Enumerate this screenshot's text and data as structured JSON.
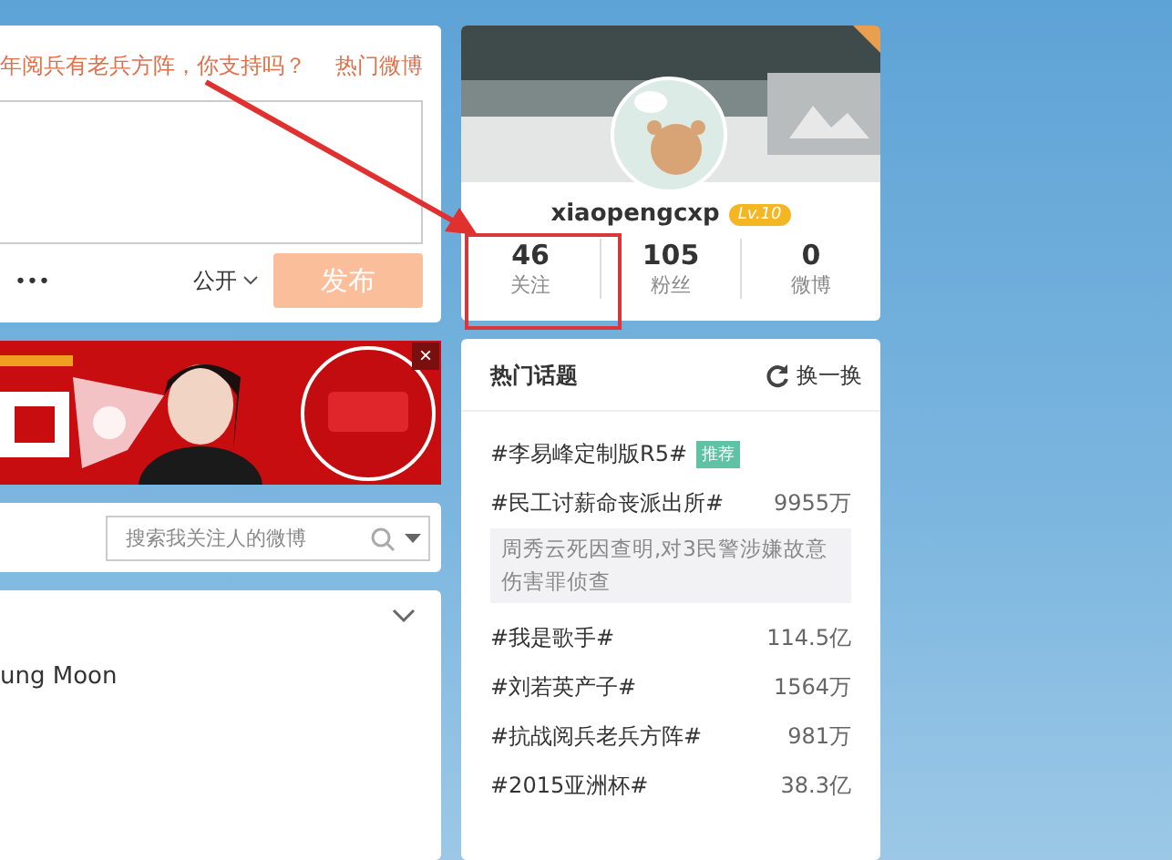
{
  "composer": {
    "prompt": "年阅兵有老兵方阵，你支持吗？",
    "hot_link": "热门微博",
    "more": "•••",
    "visibility": "公开",
    "submit": "发布"
  },
  "ad": {
    "kind": "picture",
    "close": "×"
  },
  "feed_search": {
    "placeholder": "搜索我关注人的微博"
  },
  "feed": {
    "text": "ung Moon"
  },
  "profile": {
    "name": "xiaopengcxp",
    "level": "Lv.10",
    "stats": [
      {
        "value": "46",
        "label": "关注"
      },
      {
        "value": "105",
        "label": "粉丝"
      },
      {
        "value": "0",
        "label": "微博"
      }
    ]
  },
  "topics": {
    "title": "热门话题",
    "refresh": "换一换",
    "items": [
      {
        "title": "#李易峰定制版R5#",
        "badge": "推荐"
      },
      {
        "title": "#民工讨薪命丧派出所#",
        "count": "9955万",
        "description": "周秀云死因查明,对3民警涉嫌故意伤害罪侦查"
      },
      {
        "title": "#我是歌手#",
        "count": "114.5亿"
      },
      {
        "title": "#刘若英产子#",
        "count": "1564万"
      },
      {
        "title": "#抗战阅兵老兵方阵#",
        "count": "981万"
      },
      {
        "title": "#2015亚洲杯#",
        "count": "38.3亿"
      }
    ]
  }
}
